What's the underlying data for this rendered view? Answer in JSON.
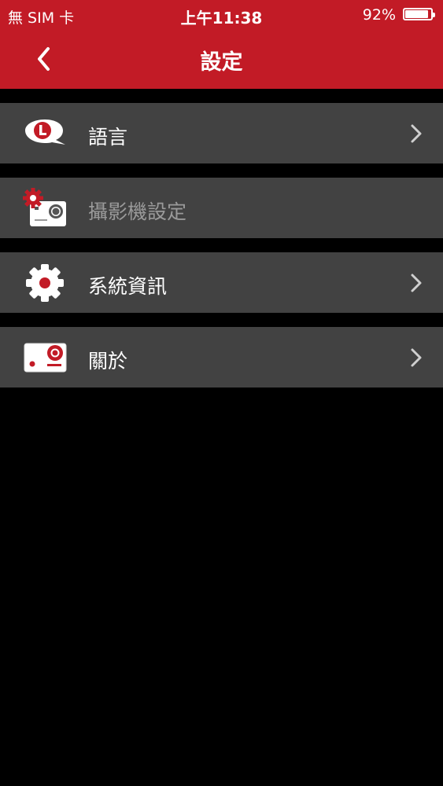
{
  "status": {
    "carrier": "無 SIM 卡",
    "time": "上午11:38",
    "battery_percent": "92%",
    "battery_level": 0.92
  },
  "nav": {
    "title": "設定",
    "back_icon": "chevron-left-icon"
  },
  "menu": {
    "items": [
      {
        "label": "語言",
        "icon": "language-bubble-icon",
        "enabled": true,
        "has_chevron": true
      },
      {
        "label": "攝影機設定",
        "icon": "camera-gear-icon",
        "enabled": false,
        "has_chevron": false
      },
      {
        "label": "系統資訊",
        "icon": "gear-icon",
        "enabled": true,
        "has_chevron": true
      },
      {
        "label": "關於",
        "icon": "device-card-icon",
        "enabled": true,
        "has_chevron": true
      }
    ]
  },
  "colors": {
    "header_red": "#c21b26",
    "row_gray": "#424242",
    "background": "#000000",
    "disabled_text": "#9a9a9a",
    "icon_red": "#c21b26"
  }
}
